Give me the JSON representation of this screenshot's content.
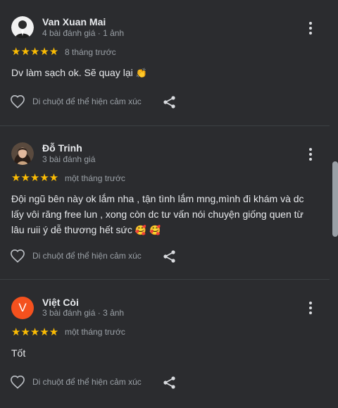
{
  "reviews": [
    {
      "name": "Van Xuan Mai",
      "meta": "4 bài đánh giá · 1 ảnh",
      "stars": "★★★★★",
      "rating": 5,
      "time": "8 tháng trước",
      "text": "Dv làm sạch ok. Sẽ quay lại",
      "emoji": "👏",
      "react_label": "Di chuột để thể hiện cảm xúc",
      "icons": {
        "avatar": "person-photo-avatar",
        "more": "more-vert-icon",
        "like": "heart-outline-icon",
        "share": "share-icon"
      }
    },
    {
      "name": "Đỗ Trinh",
      "meta": "3 bài đánh giá",
      "stars": "★★★★★",
      "rating": 5,
      "time": "một tháng trước",
      "text": "Đội ngũ bên này ok lắm nha , tận tình lắm mng,mình đi khám và dc lấy vôi răng free lun , xong còn dc tư vấn nói chuyện giống quen từ lâu ruii ý dễ thương hết sức",
      "emoji": "🥰 🥰",
      "react_label": "Di chuột để thể hiện cảm xúc",
      "icons": {
        "avatar": "person-photo-avatar",
        "more": "more-vert-icon",
        "like": "heart-outline-icon",
        "share": "share-icon"
      }
    },
    {
      "name": "Việt Còi",
      "meta": "3 bài đánh giá · 3 ảnh",
      "avatar_letter": "V",
      "stars": "★★★★★",
      "rating": 5,
      "time": "một tháng trước",
      "text": "Tốt",
      "react_label": "Di chuột để thể hiện cảm xúc",
      "icons": {
        "avatar": "letter-avatar",
        "more": "more-vert-icon",
        "like": "heart-outline-icon",
        "share": "share-icon"
      }
    }
  ],
  "colors": {
    "background": "#2b2c2f",
    "star": "#fbbc04",
    "secondary_text": "#9aa0a6",
    "avatar_letter_bg": "#f4511e",
    "divider": "#3c4043"
  }
}
